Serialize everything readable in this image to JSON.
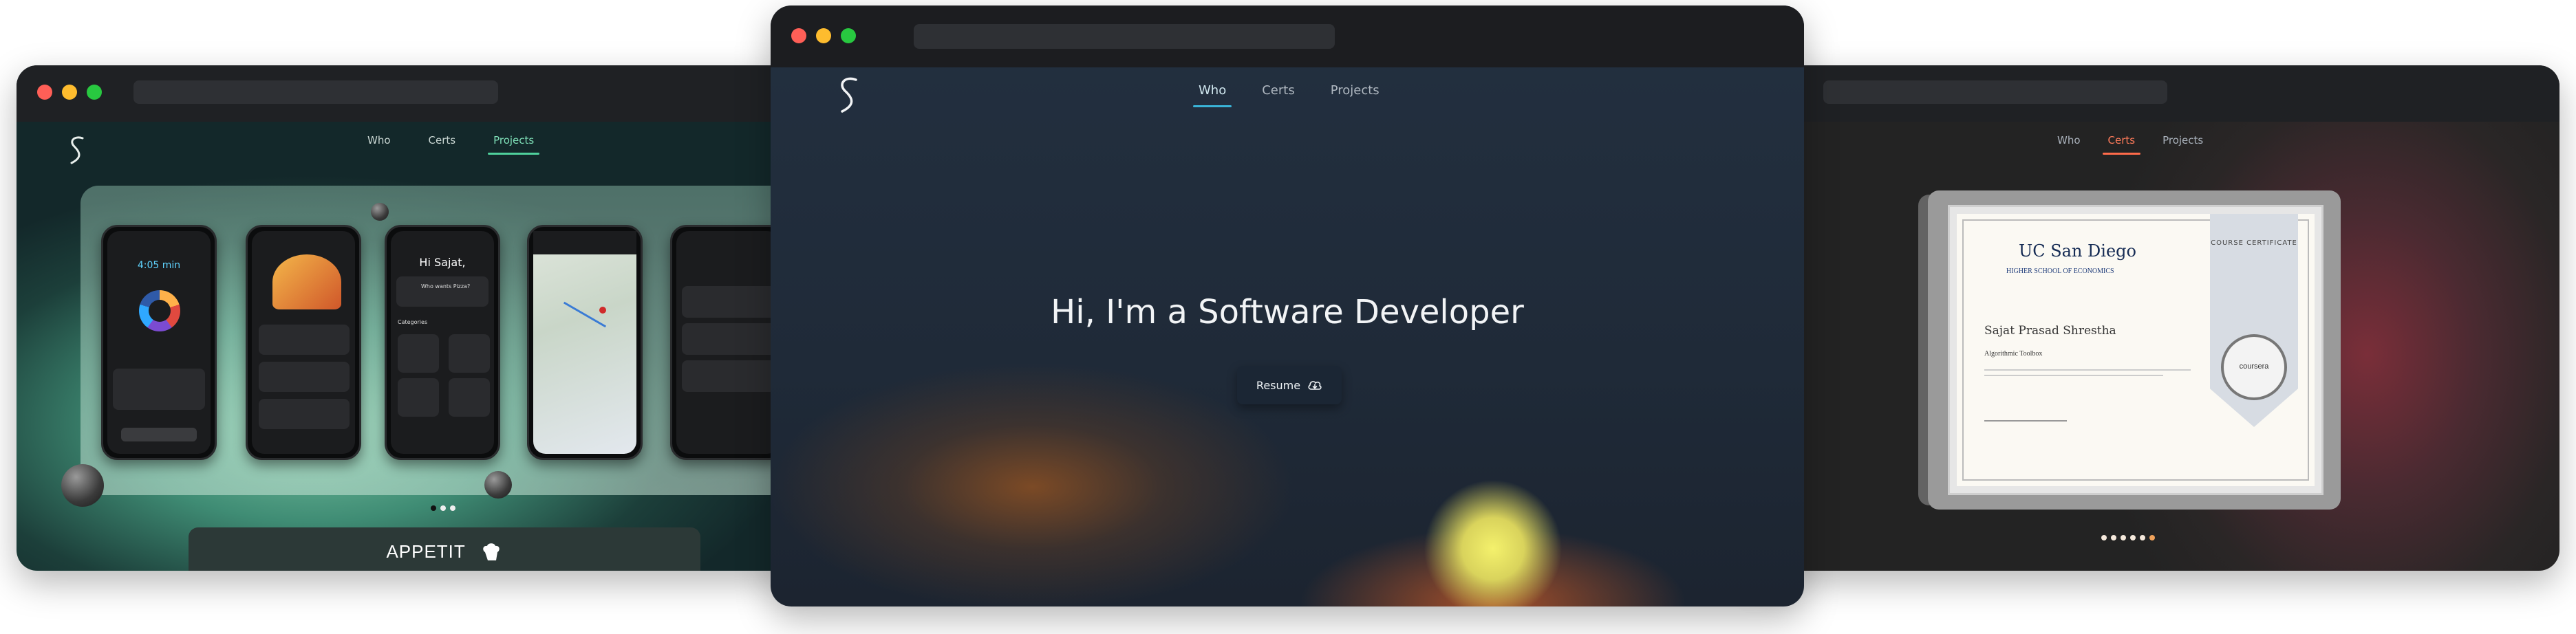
{
  "left_window": {
    "nav": [
      "Who",
      "Certs",
      "Projects"
    ],
    "active_nav": "Projects",
    "phones": [
      {
        "time": "4:05 min"
      },
      {
        "time": ""
      },
      {
        "title": "Hi Sajat,",
        "subtitle": "Who wants Pizza?",
        "section": "Categories"
      },
      {
        "time": ""
      },
      {
        "time": ""
      }
    ],
    "banner_text": "APPETIT",
    "carousel_active": 0
  },
  "center_window": {
    "nav": [
      "Who",
      "Certs",
      "Projects"
    ],
    "active_nav": "Who",
    "headline": "Hi, I'm a Software Developer",
    "resume_label": "Resume",
    "resume_icon": "cloud-download-icon",
    "accent": "#3ab4d8"
  },
  "right_window": {
    "nav": [
      "Who",
      "Certs",
      "Projects"
    ],
    "active_nav": "Certs",
    "certificate": {
      "issuer": "UC San Diego",
      "partner": "HIGHER SCHOOL OF ECONOMICS",
      "recipient": "Sajat Prasad Shrestha",
      "course": "Algorithmic Toolbox",
      "ribbon": "COURSE CERTIFICATE",
      "seal": "coursera"
    },
    "carousel_dots": 6,
    "carousel_active": 5,
    "accent": "#ff6b4a"
  }
}
